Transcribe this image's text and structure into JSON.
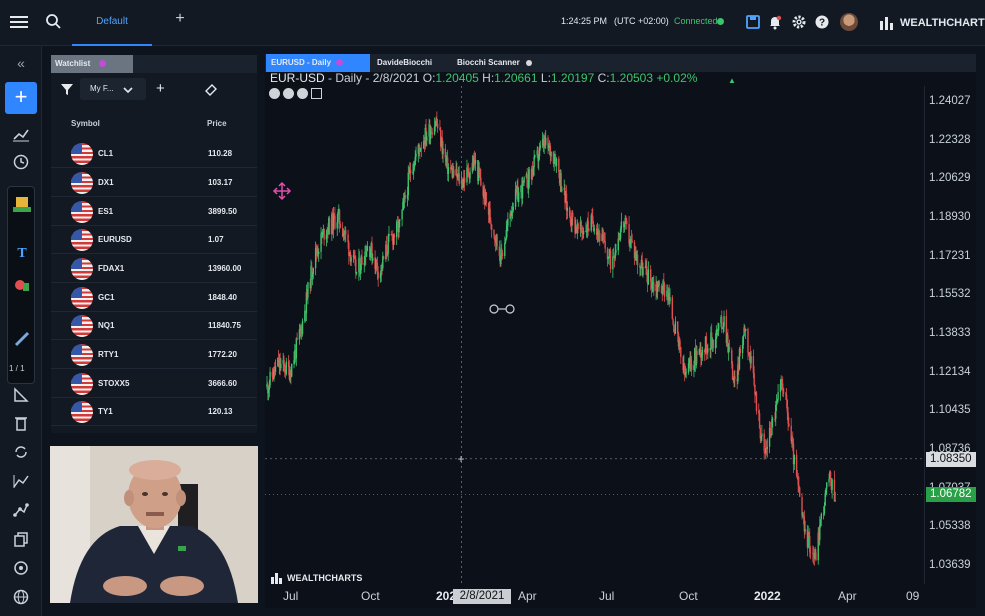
{
  "topbar": {
    "active_tab": "Default",
    "add_tab": "+",
    "time": "1:24:25 PM",
    "timezone": "(UTC +02:00)",
    "status": "Connected",
    "brand": "WEALTHCHARTS",
    "icons": [
      "menu-icon",
      "search-icon",
      "save-icon",
      "bell-icon",
      "gear-icon",
      "help-icon",
      "avatar"
    ],
    "status_color": "#3ec46d",
    "accent": "#2f86ff"
  },
  "left_toolbar": {
    "collapse": "«",
    "add": "+",
    "page_indicator": "1 / 1",
    "icons": [
      "line-chart-icon",
      "clock-icon",
      "triangle-ruler-icon",
      "trash-icon",
      "sync-icon",
      "graph-icon",
      "node-icon",
      "copy-icon",
      "target-icon",
      "globe-icon"
    ]
  },
  "watchlist": {
    "tab_label": "Watchlist",
    "list_name": "My F...",
    "add": "+",
    "col_symbol": "Symbol",
    "col_price": "Price",
    "rows": [
      {
        "symbol": "CL1",
        "price": "110.28"
      },
      {
        "symbol": "DX1",
        "price": "103.17"
      },
      {
        "symbol": "ES1",
        "price": "3899.50"
      },
      {
        "symbol": "EURUSD",
        "price": "1.07"
      },
      {
        "symbol": "FDAX1",
        "price": "13960.00"
      },
      {
        "symbol": "GC1",
        "price": "1848.40"
      },
      {
        "symbol": "NQ1",
        "price": "11840.75"
      },
      {
        "symbol": "RTY1",
        "price": "1772.20"
      },
      {
        "symbol": "STOXX5",
        "price": "3666.60"
      },
      {
        "symbol": "TY1",
        "price": "120.13"
      }
    ]
  },
  "chart_tabs": [
    {
      "label": "EURUSD - Daily"
    },
    {
      "label": "DavideBiocchi"
    },
    {
      "label": "Biocchi Scanner"
    }
  ],
  "legend": {
    "symbol": "EUR-USD",
    "sep1": " - ",
    "timeframe": "Daily",
    "sep2": " - ",
    "date": "2/8/2021",
    "o_key": "O:",
    "o": "1.20405",
    "h_key": "H:",
    "h": "1.20661",
    "l_key": "L:",
    "l": "1.20197",
    "c_key": "C:",
    "c": "1.20503",
    "change": "+0.02%",
    "up_arrow": "▲"
  },
  "crosshair": {
    "date": "2/8/2021",
    "price": "1.08350"
  },
  "last_price": "1.06782",
  "chart_brand": "WEALTHCHARTS",
  "chart_data": {
    "type": "candlestick",
    "symbol": "EUR-USD",
    "timeframe": "Daily",
    "x_ticks": [
      "Jul",
      "Oct",
      "2021",
      "Apr",
      "Jul",
      "Oct",
      "2022",
      "Apr",
      "09"
    ],
    "y_ticks": [
      "1.24027",
      "1.22328",
      "1.20629",
      "1.18930",
      "1.17231",
      "1.15532",
      "1.13833",
      "1.12134",
      "1.10435",
      "1.08736",
      "1.07037",
      "1.05338",
      "1.03639"
    ],
    "ylim": [
      1.03,
      1.245
    ],
    "x_range": [
      "2020-06-01",
      "2022-09-30"
    ],
    "path": [
      [
        "2020-06-01",
        1.115
      ],
      [
        "2020-06-15",
        1.125
      ],
      [
        "2020-07-01",
        1.122
      ],
      [
        "2020-07-15",
        1.14
      ],
      [
        "2020-08-01",
        1.172
      ],
      [
        "2020-08-15",
        1.184
      ],
      [
        "2020-09-01",
        1.19
      ],
      [
        "2020-09-10",
        1.182
      ],
      [
        "2020-09-25",
        1.165
      ],
      [
        "2020-10-10",
        1.178
      ],
      [
        "2020-10-25",
        1.165
      ],
      [
        "2020-11-05",
        1.178
      ],
      [
        "2020-11-20",
        1.186
      ],
      [
        "2020-12-05",
        1.212
      ],
      [
        "2020-12-20",
        1.224
      ],
      [
        "2021-01-06",
        1.232
      ],
      [
        "2021-01-20",
        1.212
      ],
      [
        "2021-02-08",
        1.205
      ],
      [
        "2021-02-25",
        1.214
      ],
      [
        "2021-03-15",
        1.192
      ],
      [
        "2021-03-31",
        1.172
      ],
      [
        "2021-04-15",
        1.196
      ],
      [
        "2021-05-05",
        1.206
      ],
      [
        "2021-05-25",
        1.222
      ],
      [
        "2021-06-10",
        1.216
      ],
      [
        "2021-06-25",
        1.193
      ],
      [
        "2021-07-10",
        1.183
      ],
      [
        "2021-07-30",
        1.188
      ],
      [
        "2021-08-20",
        1.17
      ],
      [
        "2021-09-05",
        1.188
      ],
      [
        "2021-09-25",
        1.17
      ],
      [
        "2021-10-15",
        1.16
      ],
      [
        "2021-11-01",
        1.158
      ],
      [
        "2021-11-24",
        1.12
      ],
      [
        "2021-12-10",
        1.13
      ],
      [
        "2021-12-31",
        1.136
      ],
      [
        "2022-01-14",
        1.145
      ],
      [
        "2022-01-28",
        1.115
      ],
      [
        "2022-02-10",
        1.143
      ],
      [
        "2022-03-07",
        1.085
      ],
      [
        "2022-03-31",
        1.118
      ],
      [
        "2022-04-15",
        1.082
      ],
      [
        "2022-04-28",
        1.052
      ],
      [
        "2022-05-12",
        1.04
      ],
      [
        "2022-05-20",
        1.058
      ],
      [
        "2022-05-30",
        1.075
      ],
      [
        "2022-06-07",
        1.068
      ]
    ],
    "colors": {
      "up": "#3ec46d",
      "down": "#e04f4f"
    }
  }
}
